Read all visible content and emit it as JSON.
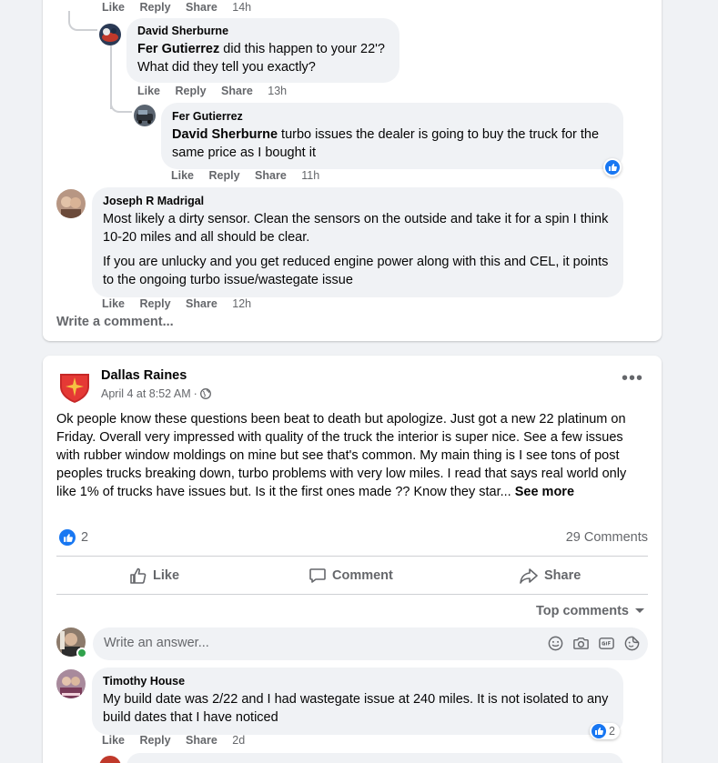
{
  "thread": {
    "top_actions": {
      "like": "Like",
      "reply": "Reply",
      "share": "Share",
      "time": "14h"
    },
    "reply1": {
      "author": "David Sherburne",
      "mention": "Fer Gutierrez",
      "text_after_mention": " did this happen to your 22'? What did they tell you exactly?",
      "actions": {
        "like": "Like",
        "reply": "Reply",
        "share": "Share",
        "time": "13h"
      }
    },
    "reply2": {
      "author": "Fer Gutierrez",
      "mention": "David Sherburne",
      "text_after_mention": " turbo issues the dealer is going to buy the truck for the same price as I bought it",
      "actions": {
        "like": "Like",
        "reply": "Reply",
        "share": "Share",
        "time": "11h"
      }
    },
    "comment3": {
      "author": "Joseph R Madrigal",
      "para1": "Most likely a dirty sensor. Clean the sensors on the outside and take it for a spin I think 10-20 miles and all should be clear.",
      "para2": "If you are unlucky and you get reduced engine power along with this and CEL, it points to the ongoing turbo issue/wastegate issue",
      "actions": {
        "like": "Like",
        "reply": "Reply",
        "share": "Share",
        "time": "12h"
      }
    },
    "write_comment": "Write a comment..."
  },
  "post": {
    "author": "Dallas Raines",
    "date": "April 4 at 8:52 AM",
    "separator": "·",
    "body": "Ok people know these questions been beat  to death but apologize.  Just got a new 22 platinum on Friday.  Overall very impressed with quality of the truck the interior is super nice.  See a few issues with rubber window moldings on mine but see that's common.    My main thing is I see tons of post peoples trucks breaking down, turbo problems with very low miles.   I read that says real world only like 1% of trucks have issues but.   Is it the first ones made ?? Know they star...",
    "see_more": "See more",
    "reaction_count": "2",
    "comments_count": "29 Comments",
    "buttons": {
      "like": "Like",
      "comment": "Comment",
      "share": "Share"
    },
    "sort_label": "Top comments",
    "write_answer_placeholder": "Write an answer...",
    "comment": {
      "author": "Timothy House",
      "text": "My build date was 2/22 and I had wastegate issue at 240 miles. It is not isolated to any build dates that I have noticed",
      "reaction_count": "2",
      "actions": {
        "like": "Like",
        "reply": "Reply",
        "share": "Share",
        "time": "2d"
      }
    }
  },
  "colors": {
    "accent": "#1877f2",
    "secondary_text": "#65676b",
    "bubble": "#f0f2f5",
    "page_bg": "#f0f2f5"
  }
}
